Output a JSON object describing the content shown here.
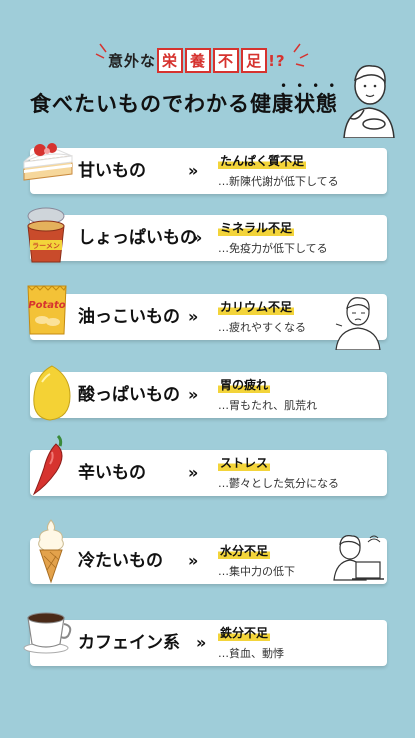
{
  "header": {
    "subtitle_pre": "意外な",
    "subtitle_chars": [
      "栄",
      "養",
      "不",
      "足"
    ],
    "subtitle_post": "!?",
    "title": "食べたいものでわかる健康状態"
  },
  "items": [
    {
      "food": "甘いもの",
      "arrow": "»",
      "deficiency": "たんぱく質不足",
      "symptom": "…新陳代謝が低下してる",
      "icon": "cake-icon"
    },
    {
      "food": "しょっぱいもの",
      "arrow": "»",
      "deficiency": "ミネラル不足",
      "symptom": "…免疫力が低下してる",
      "icon": "noodle-cup-icon",
      "icon_text": "ラーメン"
    },
    {
      "food": "油っこいもの",
      "arrow": "»",
      "deficiency": "カリウム不足",
      "symptom": "…疲れやすくなる",
      "icon": "chips-bag-icon",
      "icon_text": "Potato"
    },
    {
      "food": "酸っぱいもの",
      "arrow": "»",
      "deficiency": "胃の疲れ",
      "symptom": "…胃もたれ、肌荒れ",
      "icon": "lemon-icon"
    },
    {
      "food": "辛いもの",
      "arrow": "»",
      "deficiency": "ストレス",
      "symptom": "…鬱々とした気分になる",
      "icon": "chili-pepper-icon"
    },
    {
      "food": "冷たいもの",
      "arrow": "»",
      "deficiency": "水分不足",
      "symptom": "…集中力の低下",
      "icon": "ice-cream-icon"
    },
    {
      "food": "カフェイン系",
      "arrow": "»",
      "deficiency": "鉄分不足",
      "symptom": "…貧血、動悸",
      "icon": "coffee-cup-icon"
    }
  ],
  "colors": {
    "background": "#9fcdd9",
    "accent_red": "#d6332f",
    "highlight_yellow": "#f3d43a"
  }
}
